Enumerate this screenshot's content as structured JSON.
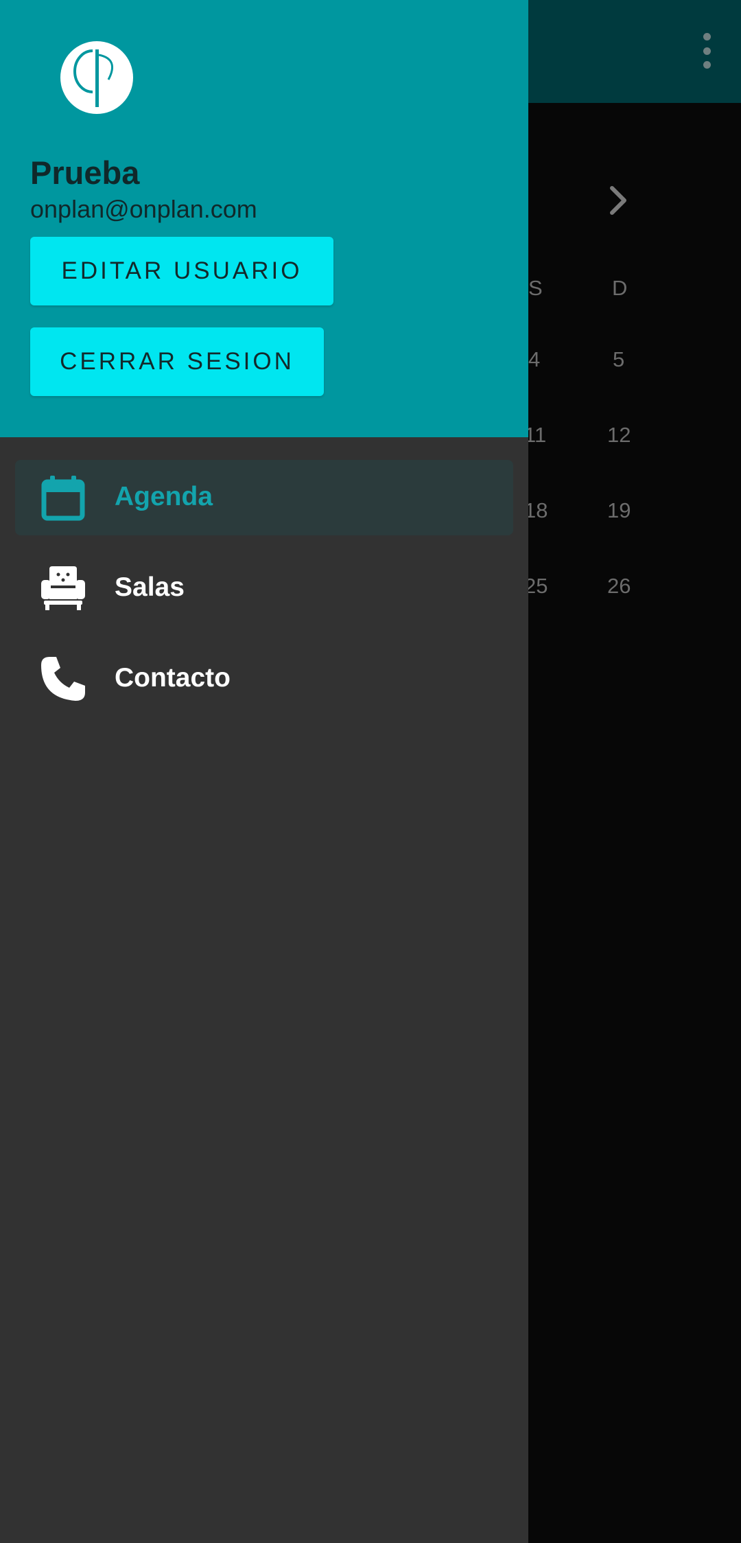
{
  "background": {
    "weekday_headers": [
      "S",
      "D"
    ],
    "day_rows": [
      [
        "4",
        "5"
      ],
      [
        "11",
        "12"
      ],
      [
        "18",
        "19"
      ],
      [
        "25",
        "26"
      ]
    ]
  },
  "drawer": {
    "user": {
      "name": "Prueba",
      "email": "onplan@onplan.com"
    },
    "buttons": {
      "edit_user": "EDITAR USUARIO",
      "logout": "CERRAR SESION"
    },
    "menu": [
      {
        "label": "Agenda",
        "icon": "calendar-icon",
        "active": true
      },
      {
        "label": "Salas",
        "icon": "armchair-icon",
        "active": false
      },
      {
        "label": "Contacto",
        "icon": "phone-icon",
        "active": false
      }
    ]
  },
  "colors": {
    "header": "#00979f",
    "button": "#00e6f0",
    "accent": "#13a4ad",
    "drawer_bg": "#323232"
  }
}
